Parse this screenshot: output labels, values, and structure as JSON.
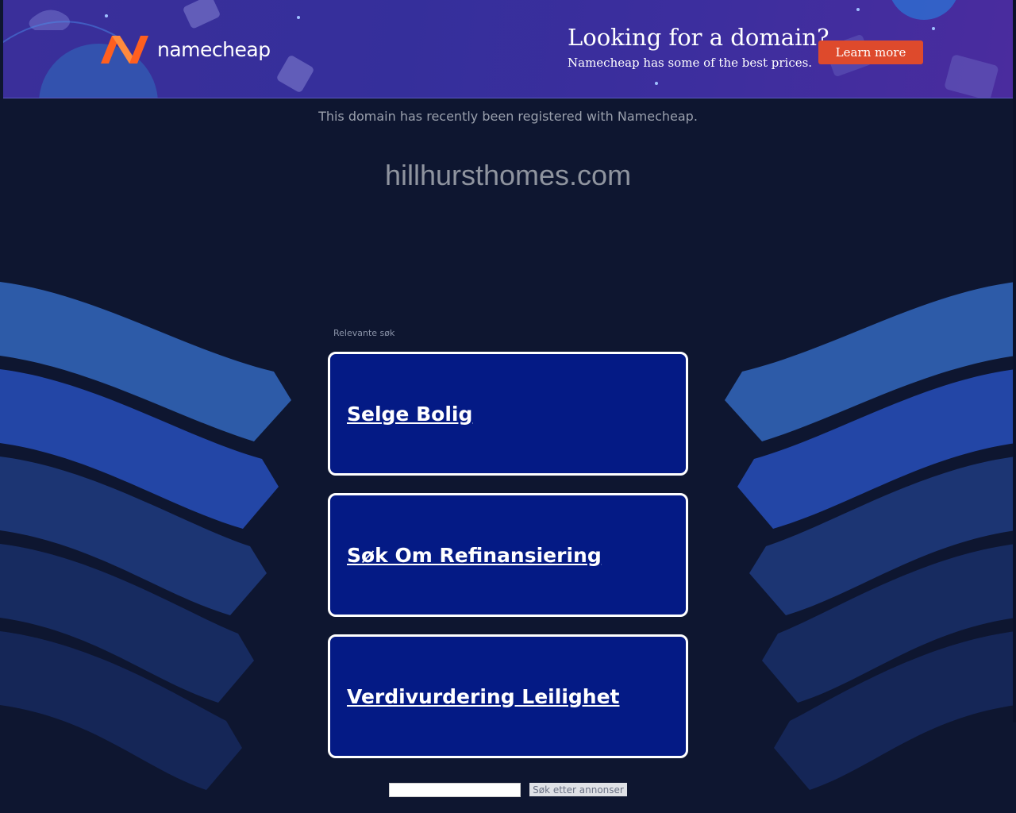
{
  "banner": {
    "logo_text": "namecheap",
    "promo_title": "Looking for a domain?",
    "promo_subtitle": "Namecheap has some of the best prices.",
    "cta_label": "Learn more",
    "brand_color": "#ff5f1f",
    "cta_color": "#de4a2c"
  },
  "notice": "This domain has recently been registered with Namecheap.",
  "domain": "hillhursthomes.com",
  "related": {
    "label": "Relevante søk",
    "links": [
      {
        "label": "Selge Bolig"
      },
      {
        "label": "Søk Om Refinansiering"
      },
      {
        "label": "Verdivurdering Leilighet"
      }
    ]
  },
  "search": {
    "input_value": "",
    "button_label": "Søk etter annonser"
  }
}
